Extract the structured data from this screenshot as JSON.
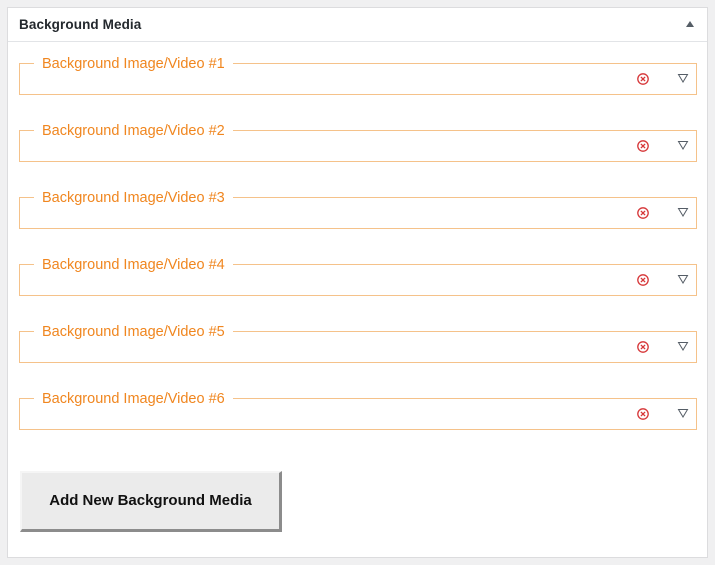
{
  "panel": {
    "title": "Background Media",
    "collapse_icon": "triangle-up-icon"
  },
  "media_items": [
    {
      "label": "Background Image/Video #1"
    },
    {
      "label": "Background Image/Video #2"
    },
    {
      "label": "Background Image/Video #3"
    },
    {
      "label": "Background Image/Video #4"
    },
    {
      "label": "Background Image/Video #5"
    },
    {
      "label": "Background Image/Video #6"
    }
  ],
  "item_icons": {
    "remove": "remove-circle-x-icon",
    "expand": "triangle-down-icon"
  },
  "add_button": {
    "label": "Add New Background Media"
  },
  "colors": {
    "accent_orange": "#f0861f",
    "group_border": "#f5c28a",
    "remove_red": "#d63638",
    "title_text": "#23282d"
  }
}
